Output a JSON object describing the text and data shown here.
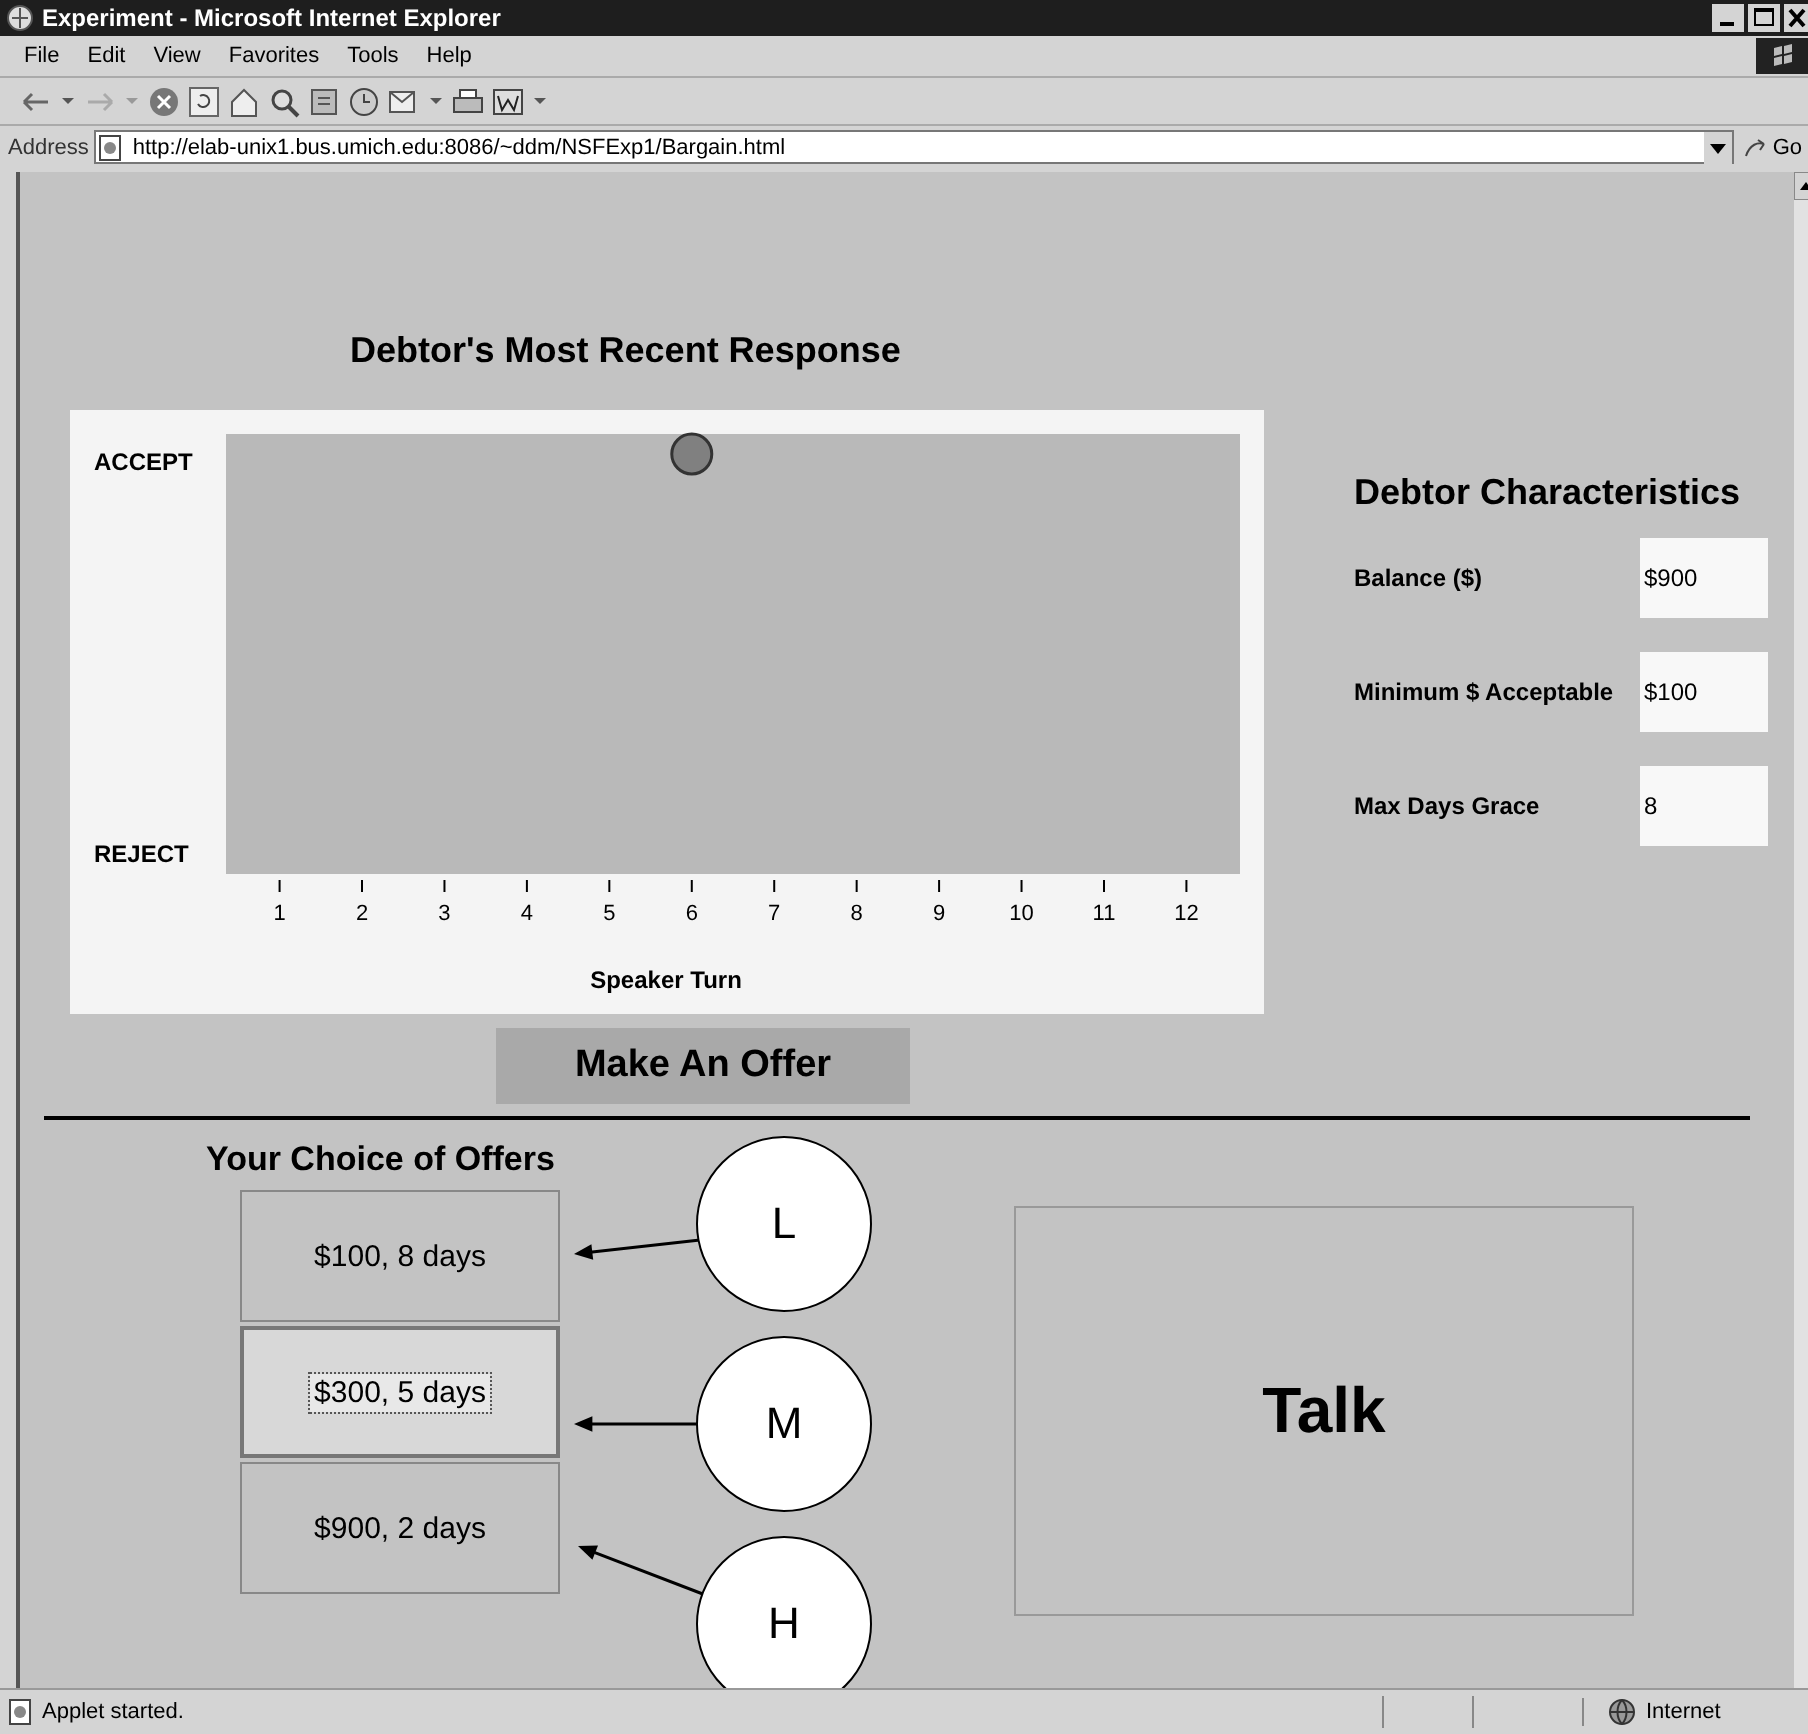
{
  "window": {
    "title": "Experiment - Microsoft Internet Explorer"
  },
  "menu": [
    "File",
    "Edit",
    "View",
    "Favorites",
    "Tools",
    "Help"
  ],
  "address_bar": {
    "label": "Address",
    "value": "http://elab-unix1.bus.umich.edu:8086/~ddm/NSFExp1/Bargain.html",
    "go": "Go"
  },
  "response_panel": {
    "title": "Debtor's Most Recent Response",
    "accept_label": "ACCEPT",
    "reject_label": "REJECT",
    "axis_title": "Speaker Turn",
    "turns": [
      {
        "label": "1",
        "kind": "empty"
      },
      {
        "label": "2",
        "kind": "empty"
      },
      {
        "label": "3",
        "kind": "empty"
      },
      {
        "label": "4",
        "kind": "empty"
      },
      {
        "label": "5",
        "kind": "empty"
      },
      {
        "label": "6",
        "kind": "accept"
      },
      {
        "label": "7",
        "kind": "empty"
      },
      {
        "label": "8",
        "kind": "empty"
      },
      {
        "label": "9",
        "kind": "empty"
      },
      {
        "label": "10",
        "kind": "empty"
      },
      {
        "label": "11",
        "kind": "empty"
      },
      {
        "label": "12",
        "kind": "empty"
      }
    ]
  },
  "characteristics": {
    "title": "Debtor Characteristics",
    "fields": [
      {
        "label": "Balance ($)",
        "value": "$900"
      },
      {
        "label": "Minimum $ Acceptable",
        "value": "$100"
      },
      {
        "label": "Max Days Grace",
        "value": "8"
      }
    ]
  },
  "offer_button": "Make An Offer",
  "offers": {
    "title": "Your Choice of Offers",
    "items": [
      {
        "label": "$100, 8 days",
        "selected": false,
        "callout": "L"
      },
      {
        "label": "$300, 5 days",
        "selected": true,
        "callout": "M"
      },
      {
        "label": "$900, 2 days",
        "selected": false,
        "callout": "H"
      }
    ]
  },
  "talk_button": "Talk",
  "status_bar": {
    "message": "Applet started.",
    "zone": "Internet"
  }
}
